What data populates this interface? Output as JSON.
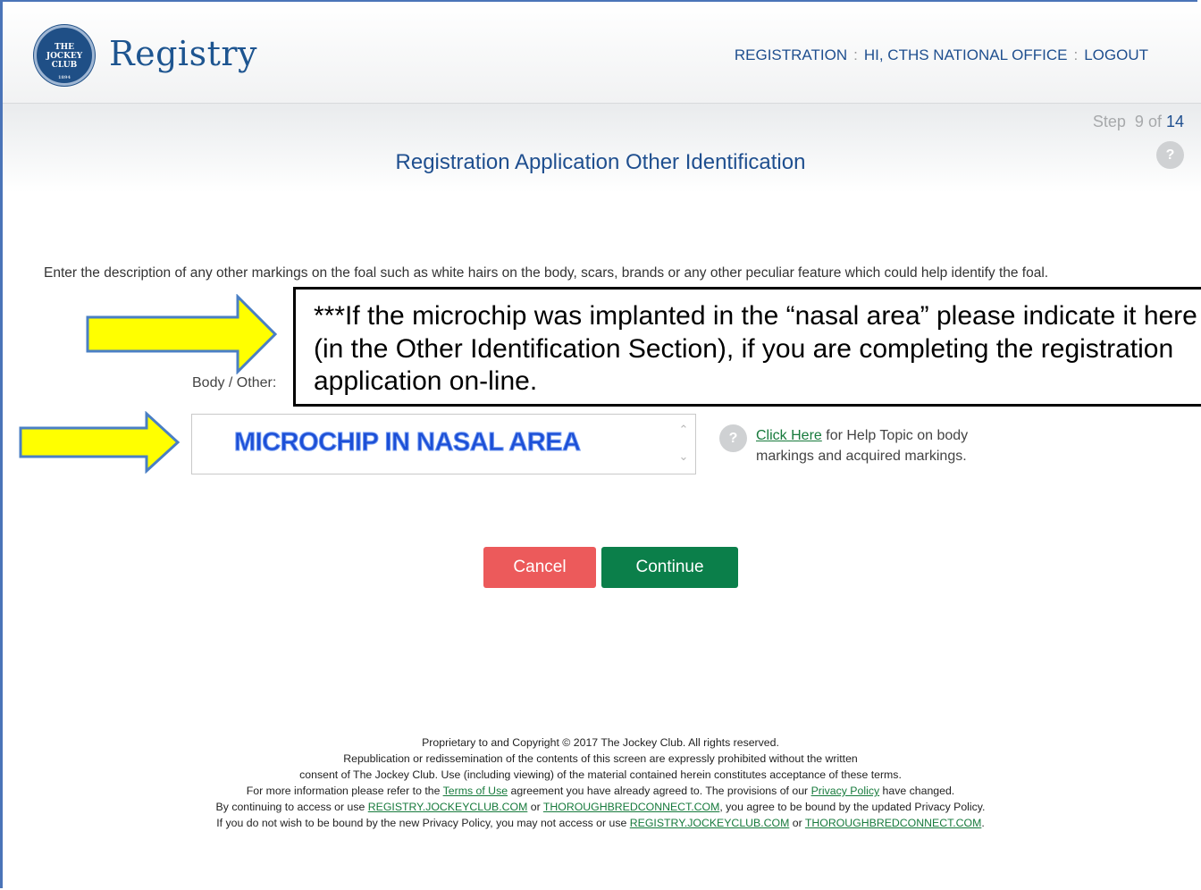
{
  "header": {
    "logo_lines": [
      "THE",
      "JOCKEY",
      "CLUB"
    ],
    "logo_year": "1894",
    "brand": "Registry",
    "nav": {
      "registration": "REGISTRATION",
      "greeting": "HI, CTHS NATIONAL OFFICE",
      "logout": "LOGOUT",
      "separator": ":"
    }
  },
  "step": {
    "label": "Step",
    "current": "9",
    "of": "of",
    "total": "14"
  },
  "help_icon_glyph": "?",
  "page_title": "Registration Application Other Identification",
  "instructions": "Enter the description of any other markings on the foal such as white hairs on the body, scars, brands or any other peculiar feature which could help identify the foal.",
  "form": {
    "field_label": "Body / Other:",
    "field_value": "MICROCHIP IN NASAL AREA",
    "help_link": "Click Here",
    "help_text": " for Help Topic on body markings and acquired markings."
  },
  "buttons": {
    "cancel": "Cancel",
    "continue": "Continue"
  },
  "callout": "***If the microchip was implanted in the “nasal area” please indicate it here (in the Other Identification Section), if you are completing the registration application on-line.",
  "footer": {
    "line1": "Proprietary to and Copyright © 2017 The Jockey Club. All rights reserved.",
    "line2": "Republication or redissemination of the contents of this screen are expressly prohibited without the written",
    "line3": "consent of The Jockey Club. Use (including viewing) of the material contained herein constitutes acceptance of these terms.",
    "line4_a": "For more information please refer to the ",
    "terms_link": "Terms of Use",
    "line4_b": " agreement you have already agreed to. The provisions of our ",
    "privacy_link": "Privacy Policy",
    "line4_c": " have changed.",
    "line5_a": "By continuing to access or use ",
    "registry_link": "REGISTRY.JOCKEYCLUB.COM",
    "or": " or ",
    "tbc_link": "THOROUGHBREDCONNECT.COM",
    "line5_b": ", you agree to be bound by the updated Privacy Policy.",
    "line6_a": "If you do not wish to be bound by the new Privacy Policy, you may not access or use ",
    "period": "."
  },
  "colors": {
    "brand_blue": "#1f4f8f",
    "cancel_red": "#ec5a5b",
    "continue_green": "#0b7f4a",
    "arrow_fill": "#ffff00",
    "arrow_stroke": "#4a7fc4"
  },
  "icons": [
    "help-icon",
    "arrow-right-icon",
    "chevron-up-icon",
    "chevron-down-icon",
    "jockey-club-seal-icon"
  ]
}
